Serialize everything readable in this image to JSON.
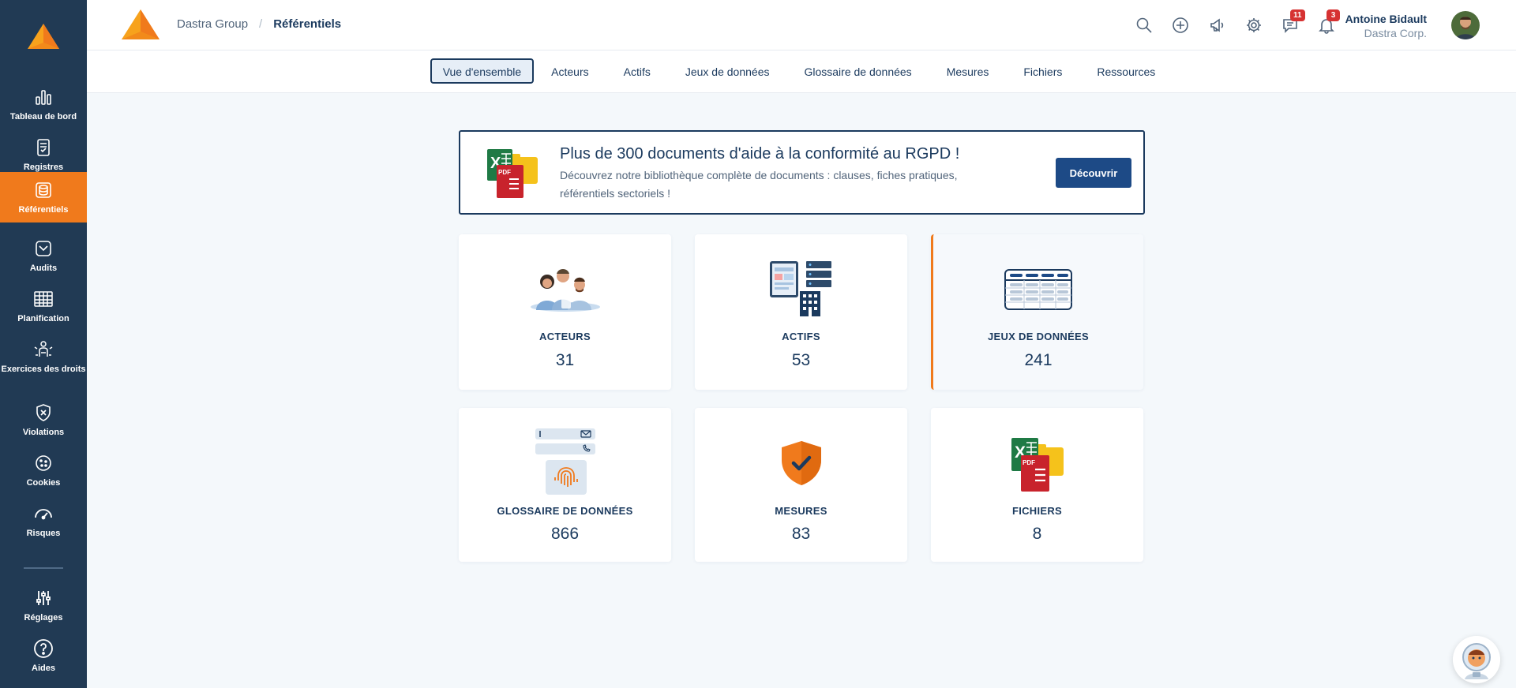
{
  "sidebar": {
    "items": [
      {
        "label": "Tableau de bord",
        "icon": "bar-chart-icon"
      },
      {
        "label": "Registres",
        "icon": "register-icon"
      },
      {
        "label": "Référentiels",
        "icon": "database-icon",
        "active": true
      },
      {
        "label": "Audits",
        "icon": "audit-icon"
      },
      {
        "label": "Planification",
        "icon": "calendar-grid-icon"
      },
      {
        "label": "Exercices des droits",
        "icon": "person-rights-icon"
      },
      {
        "label": "Violations",
        "icon": "shield-x-icon"
      },
      {
        "label": "Cookies",
        "icon": "cookie-icon"
      },
      {
        "label": "Risques",
        "icon": "gauge-icon"
      }
    ],
    "bottom_items": [
      {
        "label": "Réglages",
        "icon": "sliders-icon"
      },
      {
        "label": "Aides",
        "icon": "help-circle-icon"
      }
    ]
  },
  "header": {
    "breadcrumb": {
      "org": "Dastra Group",
      "separator": "/",
      "current": "Référentiels"
    },
    "icons": [
      "search-icon",
      "add-circle-icon",
      "megaphone-icon",
      "gear-icon",
      "chat-icon",
      "bell-icon"
    ],
    "chat_badge": "11",
    "bell_badge": "3",
    "user": {
      "name": "Antoine Bidault",
      "company": "Dastra Corp."
    }
  },
  "tabs": [
    {
      "label": "Vue d'ensemble",
      "active": true
    },
    {
      "label": "Acteurs"
    },
    {
      "label": "Actifs"
    },
    {
      "label": "Jeux de données"
    },
    {
      "label": "Glossaire de données"
    },
    {
      "label": "Mesures"
    },
    {
      "label": "Fichiers"
    },
    {
      "label": "Ressources"
    }
  ],
  "promo": {
    "title": "Plus de 300 documents d'aide à la conformité au RGPD !",
    "description": "Découvrez notre bibliothèque complète de documents : clauses, fiches pratiques, référentiels sectoriels !",
    "button": "Découvrir"
  },
  "cards": [
    {
      "label": "ACTEURS",
      "value": "31"
    },
    {
      "label": "ACTIFS",
      "value": "53"
    },
    {
      "label": "JEUX DE DONNÉES",
      "value": "241",
      "selected": true
    },
    {
      "label": "GLOSSAIRE DE DONNÉES",
      "value": "866"
    },
    {
      "label": "MESURES",
      "value": "83"
    },
    {
      "label": "FICHIERS",
      "value": "8"
    }
  ],
  "colors": {
    "sidebar": "#213a54",
    "accent": "#f07a1c",
    "primary": "#1d4a86",
    "text": "#1b3a5e",
    "badge": "#d63232"
  }
}
